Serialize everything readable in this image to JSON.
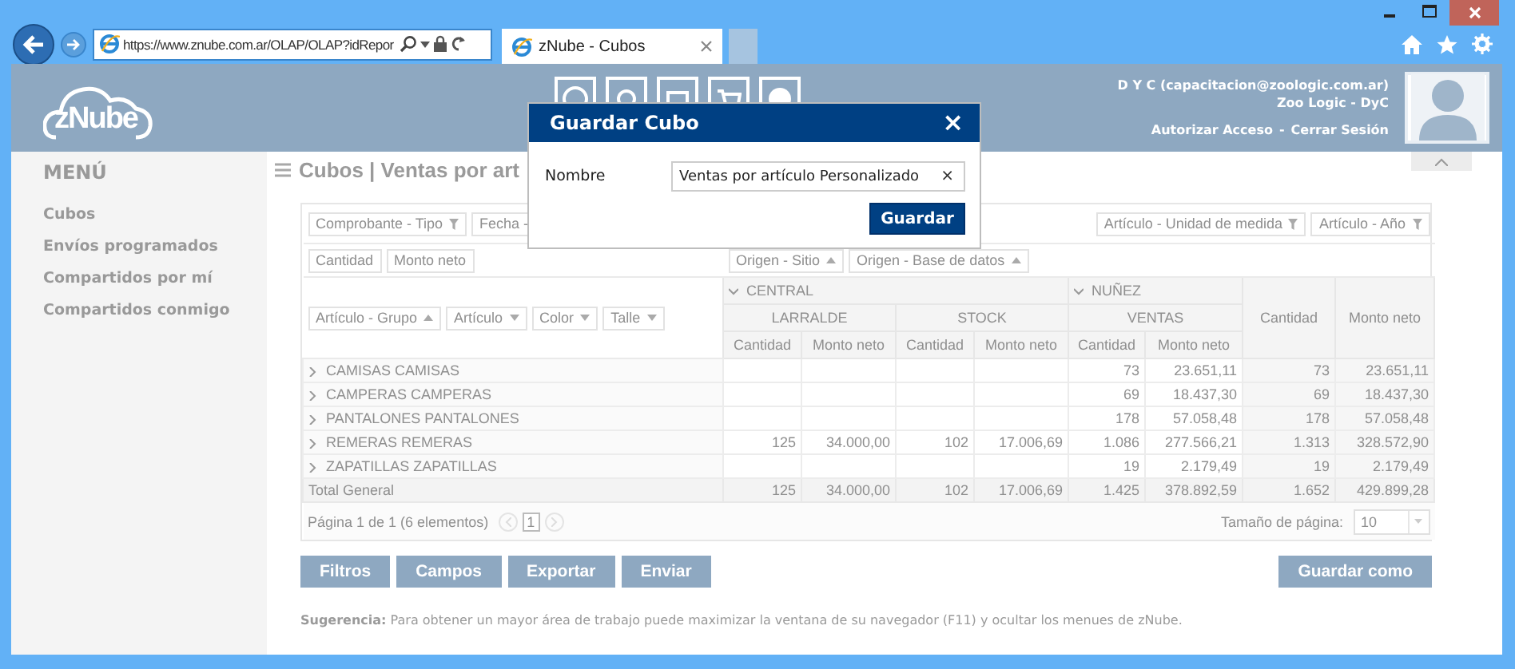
{
  "browser": {
    "address": "https://www.znube.com.ar/OLAP/OLAP?idRepor",
    "tab_title": "zNube - Cubos"
  },
  "header": {
    "logo": "zNube",
    "user_name": "D Y C (capacitacion@zoologic.com.ar)",
    "company": "Zoo Logic - DyC",
    "links": [
      "Autorizar Acceso",
      "-",
      "Cerrar Sesión"
    ]
  },
  "sidebar": {
    "title": "MENÚ",
    "items": [
      {
        "label": "Cubos"
      },
      {
        "label": "Envíos programados"
      },
      {
        "label": "Compartidos por mí"
      },
      {
        "label": "Compartidos conmigo"
      }
    ]
  },
  "page_title": "Cubos | Ventas por art",
  "pivot": {
    "filter_fields": [
      {
        "label": "Comprobante - Tipo",
        "icon": true
      },
      {
        "label": "Fecha -",
        "icon": false
      },
      {
        "label": "Artículo - Unidad de medida",
        "icon": true
      },
      {
        "label": "Artículo - Año",
        "icon": true
      }
    ],
    "data_fields": [
      "Cantidad",
      "Monto neto"
    ],
    "column_fields": [
      {
        "label": "Origen - Sitio",
        "descending": false
      },
      {
        "label": "Origen - Base de datos",
        "descending": false
      }
    ],
    "row_fields": [
      {
        "label": "Artículo - Grupo",
        "descending": false
      },
      {
        "label": "Artículo",
        "descending": true
      },
      {
        "label": "Color",
        "descending": true
      },
      {
        "label": "Talle",
        "descending": true
      }
    ],
    "column_groups": [
      {
        "label": "CENTRAL",
        "expanded": true,
        "children": [
          "LARRALDE",
          "STOCK"
        ]
      },
      {
        "label": "NUÑEZ",
        "expanded": true,
        "children": [
          "VENTAS"
        ]
      }
    ],
    "measure_headers": [
      "Cantidad",
      "Monto neto",
      "Cantidad",
      "Monto neto",
      "Cantidad",
      "Monto neto"
    ],
    "grand_total_headers": [
      "Cantidad",
      "Monto neto"
    ],
    "rows": [
      {
        "label": "CAMISAS CAMISAS",
        "expanded": false,
        "cells": [
          null,
          null,
          null,
          null,
          "73",
          "23.651,11",
          "73",
          "23.651,11"
        ]
      },
      {
        "label": "CAMPERAS CAMPERAS",
        "expanded": false,
        "cells": [
          null,
          null,
          null,
          null,
          "69",
          "18.437,30",
          "69",
          "18.437,30"
        ]
      },
      {
        "label": "PANTALONES PANTALONES",
        "expanded": false,
        "cells": [
          null,
          null,
          null,
          null,
          "178",
          "57.058,48",
          "178",
          "57.058,48"
        ]
      },
      {
        "label": "REMERAS REMERAS",
        "expanded": false,
        "cells": [
          "125",
          "34.000,00",
          "102",
          "17.006,69",
          "1.086",
          "277.566,21",
          "1.313",
          "328.572,90"
        ]
      },
      {
        "label": "ZAPATILLAS ZAPATILLAS",
        "expanded": false,
        "cells": [
          null,
          null,
          null,
          null,
          "19",
          "2.179,49",
          "19",
          "2.179,49"
        ]
      }
    ],
    "total": {
      "label": "Total General",
      "cells": [
        "125",
        "34.000,00",
        "102",
        "17.006,69",
        "1.425",
        "378.892,59",
        "1.652",
        "429.899,28"
      ]
    },
    "pager": {
      "summary": "Página 1 de 1 (6 elementos)",
      "pages": [
        {
          "label": "1",
          "selected": true
        }
      ],
      "page_size_label": "Tamaño de página:",
      "page_size": "10"
    }
  },
  "actions": [
    "Filtros",
    "Campos",
    "Exportar",
    "Enviar"
  ],
  "save_as": "Guardar como",
  "hint": "**Sugerencia:** Para obtener un mayor área de trabajo puede maximizar la ventana de su navegador (F11) y ocultar los menues de zNube.",
  "dialog": {
    "title": "Guardar Cubo",
    "close": "×",
    "field_label": "Nombre",
    "field_value": "Ventas por artículo Personalizado",
    "clear": "×",
    "button": "Guardar"
  }
}
